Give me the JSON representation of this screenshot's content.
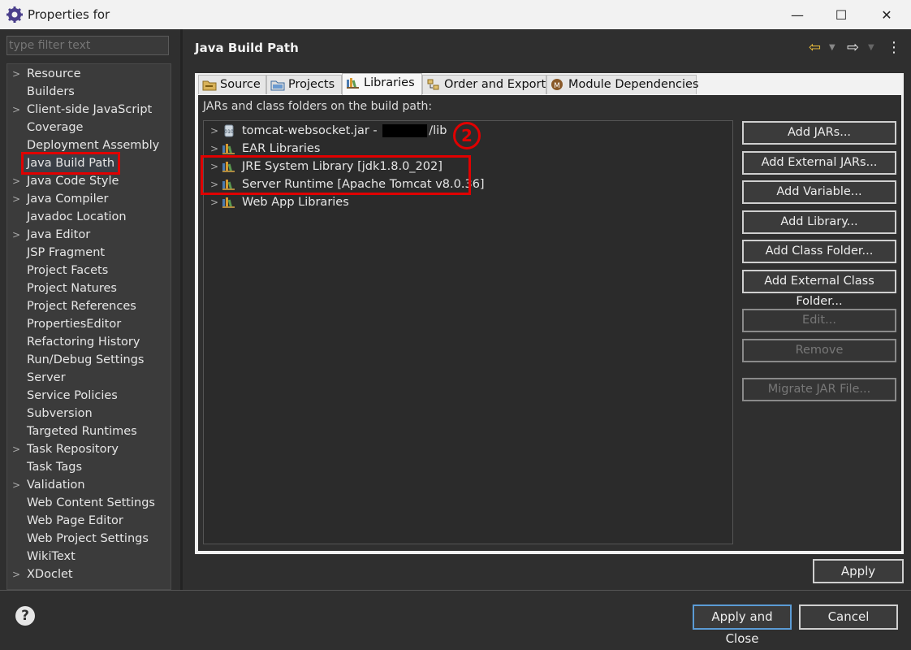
{
  "window": {
    "title": "Properties for",
    "minimize_glyph": "—",
    "maximize_glyph": "☐",
    "close_glyph": "✕"
  },
  "filter": {
    "placeholder": "type filter text"
  },
  "sidebar": {
    "items": [
      {
        "label": "Resource",
        "expandable": true
      },
      {
        "label": "Builders",
        "expandable": false
      },
      {
        "label": "Client-side JavaScript",
        "expandable": true
      },
      {
        "label": "Coverage",
        "expandable": false
      },
      {
        "label": "Deployment Assembly",
        "expandable": false
      },
      {
        "label": "Java Build Path",
        "expandable": false,
        "selected": true
      },
      {
        "label": "Java Code Style",
        "expandable": true
      },
      {
        "label": "Java Compiler",
        "expandable": true
      },
      {
        "label": "Javadoc Location",
        "expandable": false
      },
      {
        "label": "Java Editor",
        "expandable": true
      },
      {
        "label": "JSP Fragment",
        "expandable": false
      },
      {
        "label": "Project Facets",
        "expandable": false
      },
      {
        "label": "Project Natures",
        "expandable": false
      },
      {
        "label": "Project References",
        "expandable": false
      },
      {
        "label": "PropertiesEditor",
        "expandable": false
      },
      {
        "label": "Refactoring History",
        "expandable": false
      },
      {
        "label": "Run/Debug Settings",
        "expandable": false
      },
      {
        "label": "Server",
        "expandable": false
      },
      {
        "label": "Service Policies",
        "expandable": false
      },
      {
        "label": "Subversion",
        "expandable": false
      },
      {
        "label": "Targeted Runtimes",
        "expandable": false
      },
      {
        "label": "Task Repository",
        "expandable": true
      },
      {
        "label": "Task Tags",
        "expandable": false
      },
      {
        "label": "Validation",
        "expandable": true
      },
      {
        "label": "Web Content Settings",
        "expandable": false
      },
      {
        "label": "Web Page Editor",
        "expandable": false
      },
      {
        "label": "Web Project Settings",
        "expandable": false
      },
      {
        "label": "WikiText",
        "expandable": false
      },
      {
        "label": "XDoclet",
        "expandable": true
      }
    ]
  },
  "page": {
    "title": "Java Build Path",
    "back_glyph": "⇦",
    "forward_glyph": "⇨",
    "menu_glyph": "⋮"
  },
  "tabs": [
    {
      "label": "Source",
      "icon": "source-folder-icon"
    },
    {
      "label": "Projects",
      "icon": "projects-icon"
    },
    {
      "label": "Libraries",
      "icon": "library-icon",
      "active": true
    },
    {
      "label": "Order and Export",
      "icon": "order-export-icon"
    },
    {
      "label": "Module Dependencies",
      "icon": "module-icon"
    }
  ],
  "libraries": {
    "subtitle": "JARs and class folders on the build path:",
    "items": [
      {
        "label_pre": "tomcat-websocket.jar - ",
        "label_post": "/lib",
        "icon": "jar-icon"
      },
      {
        "label": "EAR Libraries",
        "icon": "library-icon"
      },
      {
        "label": "JRE System Library [jdk1.8.0_202]",
        "icon": "library-icon"
      },
      {
        "label": "Server Runtime [Apache Tomcat v8.0.36]",
        "icon": "library-icon"
      },
      {
        "label": "Web App Libraries",
        "icon": "library-icon"
      }
    ],
    "callout": "2"
  },
  "buttons": {
    "add_jars": "Add JARs...",
    "add_external_jars": "Add External JARs...",
    "add_variable": "Add Variable...",
    "add_library": "Add Library...",
    "add_class_folder": "Add Class Folder...",
    "add_external_class_folder": "Add External Class Folder...",
    "edit": "Edit...",
    "remove": "Remove",
    "migrate_jar": "Migrate JAR File..."
  },
  "apply": "Apply",
  "footer": {
    "help_glyph": "?",
    "apply_close": "Apply and Close",
    "cancel": "Cancel"
  },
  "colors": {
    "highlight": "#e00000",
    "background": "#2f2f2f"
  }
}
